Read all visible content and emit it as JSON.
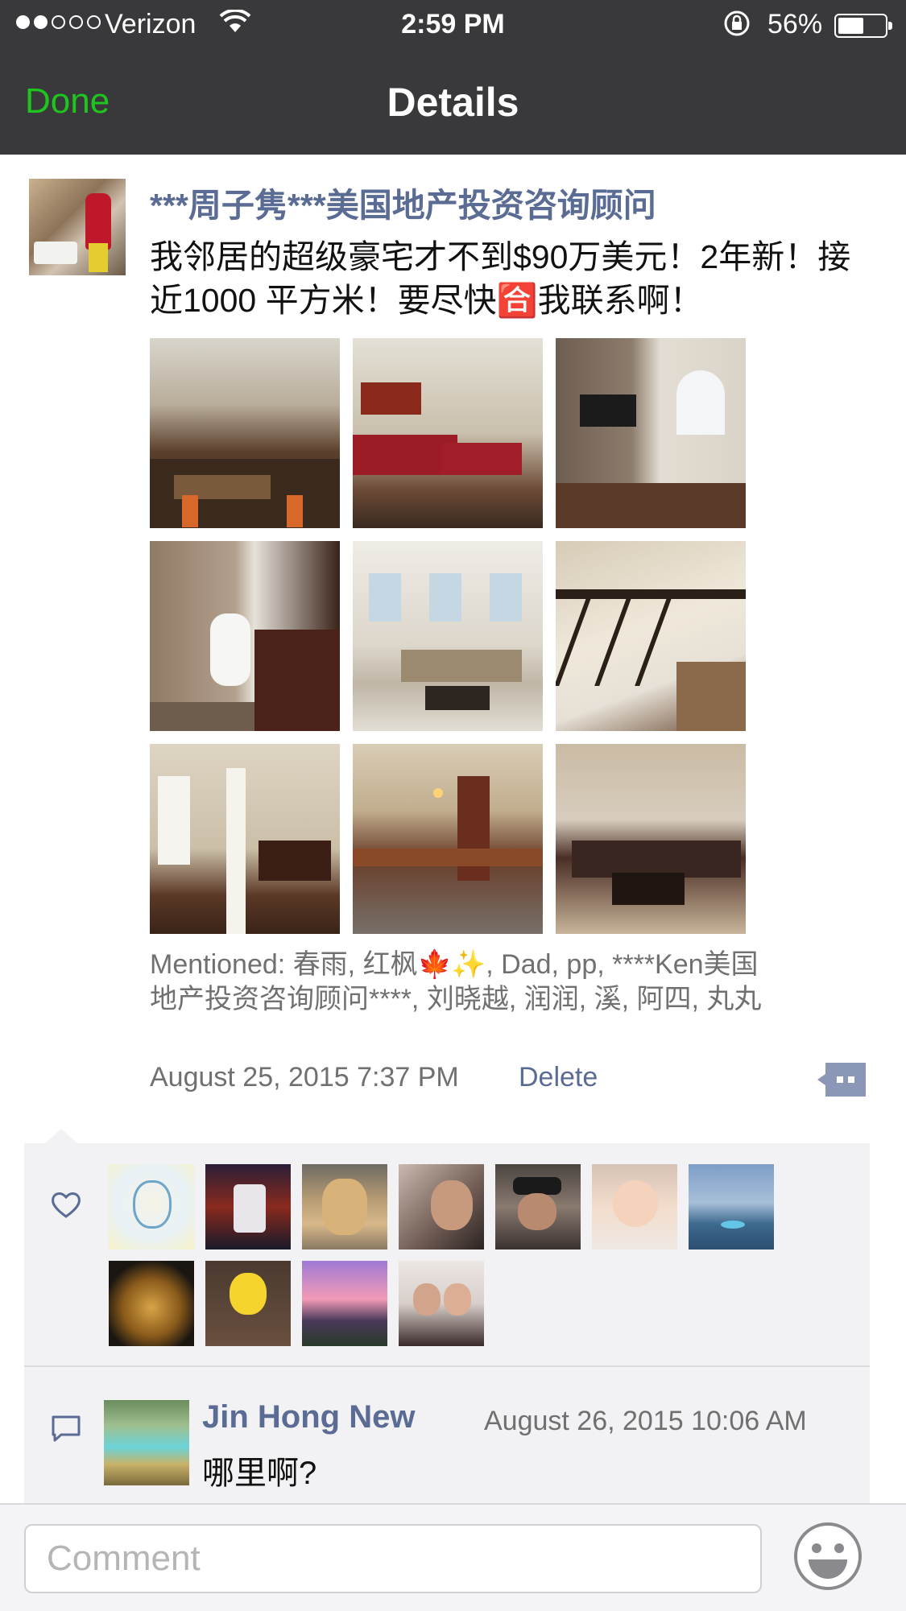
{
  "status_bar": {
    "carrier": "Verizon",
    "time": "2:59 PM",
    "battery": "56%",
    "battery_level": 0.56,
    "signal_bars_filled": 2,
    "signal_bars_total": 5
  },
  "nav": {
    "done_label": "Done",
    "title": "Details",
    "accent_color": "#1fc51f"
  },
  "post": {
    "author": "***周子隽***美国地产投资咨询顾问",
    "text": "我邻居的超级豪宅才不到$90万美元！2年新！接近1000 平方米！要尽快🈴我联系啊！",
    "photos": [
      "kitchen-dining",
      "living-room-red-sofa",
      "great-room-fireplace",
      "bathroom",
      "sunroom",
      "staircase",
      "dining-room",
      "basement-bar",
      "basement-sectional"
    ],
    "mentioned_label": "Mentioned:",
    "mentioned": "春雨, 红枫🍁✨, Dad, pp, ****Ken美国地产投资咨询顾问****, 刘晓越, 润润, 溪, 阿四, 丸丸",
    "date": "August 25, 2015 7:37 PM",
    "delete_label": "Delete",
    "link_color": "#5a6b94"
  },
  "likes": {
    "count": 11,
    "avatars": [
      "anime-girl-avatar",
      "mvp-basketball-avatar",
      "golden-retriever-avatar",
      "man-selfie-avatar",
      "man-cap-avatar",
      "baby-avatar",
      "blue-landscape-avatar",
      "golden-buddha-avatar",
      "pikachu-avatar",
      "sunset-mountain-avatar",
      "couple-avatar"
    ]
  },
  "comments": [
    {
      "author": "Jin Hong New",
      "time": "August 26, 2015 10:06 AM",
      "text": "哪里啊?"
    }
  ],
  "comment_bar": {
    "placeholder": "Comment"
  }
}
